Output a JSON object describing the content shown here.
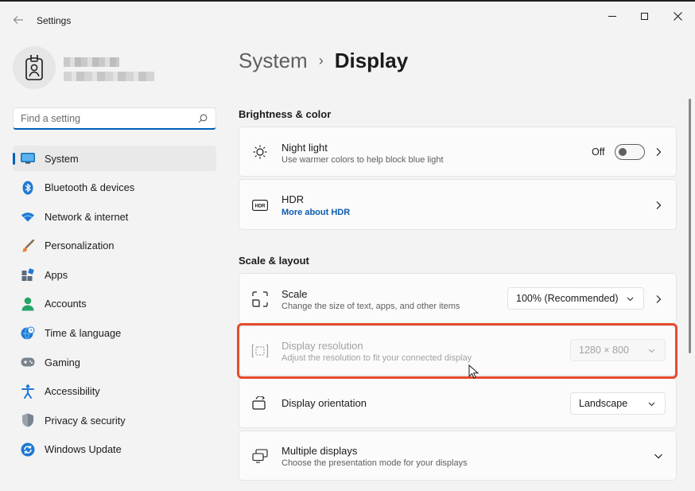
{
  "window": {
    "title": "Settings"
  },
  "profile": {
    "avatar_icon": "id-badge-icon"
  },
  "search": {
    "placeholder": "Find a setting",
    "value": ""
  },
  "sidebar": {
    "items": [
      {
        "label": "System",
        "icon": "monitor-icon",
        "active": true
      },
      {
        "label": "Bluetooth & devices",
        "icon": "bluetooth-icon",
        "active": false
      },
      {
        "label": "Network & internet",
        "icon": "wifi-icon",
        "active": false
      },
      {
        "label": "Personalization",
        "icon": "brush-icon",
        "active": false
      },
      {
        "label": "Apps",
        "icon": "apps-icon",
        "active": false
      },
      {
        "label": "Accounts",
        "icon": "person-icon",
        "active": false
      },
      {
        "label": "Time & language",
        "icon": "globe-clock-icon",
        "active": false
      },
      {
        "label": "Gaming",
        "icon": "gamepad-icon",
        "active": false
      },
      {
        "label": "Accessibility",
        "icon": "accessibility-icon",
        "active": false
      },
      {
        "label": "Privacy & security",
        "icon": "shield-icon",
        "active": false
      },
      {
        "label": "Windows Update",
        "icon": "update-icon",
        "active": false
      }
    ]
  },
  "breadcrumb": {
    "parent": "System",
    "separator": "›",
    "current": "Display"
  },
  "sections": {
    "brightness_color": {
      "title": "Brightness & color",
      "night_light": {
        "title": "Night light",
        "subtitle": "Use warmer colors to help block blue light",
        "toggle_label": "Off",
        "toggle_on": false
      },
      "hdr": {
        "title": "HDR",
        "link": "More about HDR"
      }
    },
    "scale_layout": {
      "title": "Scale & layout",
      "scale": {
        "title": "Scale",
        "subtitle": "Change the size of text, apps, and other items",
        "value": "100% (Recommended)"
      },
      "display_resolution": {
        "title": "Display resolution",
        "subtitle": "Adjust the resolution to fit your connected display",
        "value": "1280 × 800",
        "disabled": true
      },
      "display_orientation": {
        "title": "Display orientation",
        "value": "Landscape"
      },
      "multiple_displays": {
        "title": "Multiple displays",
        "subtitle": "Choose the presentation mode for your displays"
      }
    }
  },
  "colors": {
    "accent": "#005fb8",
    "highlight": "#e64b2f",
    "background": "#f3f3f3",
    "card": "#fbfbfb",
    "link": "#0f5cb0"
  }
}
